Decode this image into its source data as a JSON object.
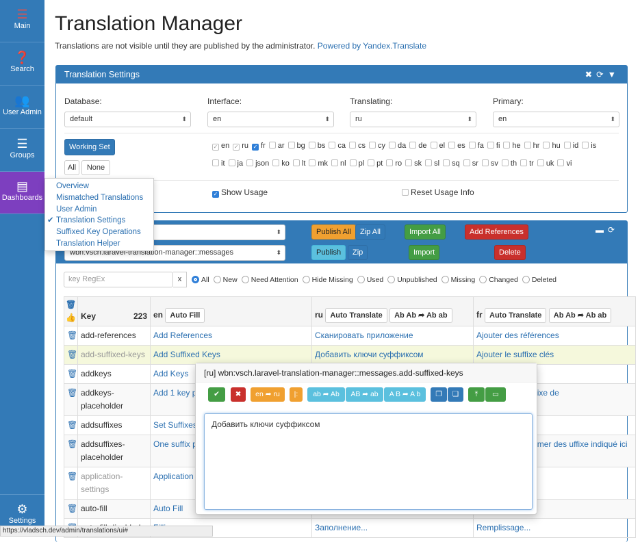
{
  "sidebar": {
    "items": [
      {
        "label": "Main",
        "icon": "hamburger-icon"
      },
      {
        "label": "Search",
        "icon": "question-icon"
      },
      {
        "label": "User Admin",
        "icon": "users-icon"
      },
      {
        "label": "Groups",
        "icon": "list-icon"
      },
      {
        "label": "Dashboards",
        "icon": "dashboard-icon"
      },
      {
        "label": "Settings",
        "icon": "gear-icon"
      }
    ]
  },
  "header": {
    "title": "Translation Manager",
    "intro": "Translations are not visible until they are published by the administrator.",
    "powered": "Powered by Yandex.Translate"
  },
  "settings": {
    "title": "Translation Settings",
    "database_label": "Database:",
    "database": "default",
    "interface_label": "Interface:",
    "interface": "en",
    "translating_label": "Translating:",
    "translating": "ru",
    "primary_label": "Primary:",
    "primary": "en",
    "working_set": "Working Set",
    "all": "All",
    "none": "None",
    "show_usage": "Show Usage",
    "reset_usage": "Reset Usage Info",
    "langs_row1": [
      {
        "code": "en",
        "state": "dim"
      },
      {
        "code": "ru",
        "state": "dim"
      },
      {
        "code": "fr",
        "state": "on"
      },
      {
        "code": "ar"
      },
      {
        "code": "bg"
      },
      {
        "code": "bs"
      },
      {
        "code": "ca"
      },
      {
        "code": "cs"
      },
      {
        "code": "cy"
      },
      {
        "code": "da"
      },
      {
        "code": "de"
      },
      {
        "code": "el"
      },
      {
        "code": "es"
      },
      {
        "code": "fa"
      },
      {
        "code": "fi"
      },
      {
        "code": "he"
      },
      {
        "code": "hr"
      },
      {
        "code": "hu"
      },
      {
        "code": "id"
      },
      {
        "code": "is"
      }
    ],
    "langs_row2": [
      "it",
      "ja",
      "json",
      "ko",
      "lt",
      "mk",
      "nl",
      "pl",
      "pt",
      "ro",
      "sk",
      "sl",
      "sq",
      "sr",
      "sv",
      "th",
      "tr",
      "uk",
      "vi"
    ]
  },
  "menu": {
    "items": [
      "Overview",
      "Mismatched Translations",
      "User Admin",
      "Translation Settings",
      "Suffixed Key Operations",
      "Translation Helper"
    ],
    "checked": "Translation Settings"
  },
  "groups": {
    "group": "wbn:vsch.laravel-translation-manager::messages",
    "publish_all": "Publish All",
    "zip_all": "Zip All",
    "import_all": "Import All",
    "add_references": "Add References",
    "publish": "Publish",
    "zip": "Zip",
    "import": "Import",
    "delete": "Delete"
  },
  "filter": {
    "placeholder": "key RegEx",
    "clear": "x",
    "options": [
      "All",
      "New",
      "Need Attention",
      "Hide Missing",
      "Used",
      "Unpublished",
      "Missing",
      "Changed",
      "Deleted"
    ],
    "selected": "All"
  },
  "table": {
    "key_header": "Key",
    "count": "223",
    "en": "en",
    "auto_fill": "Auto Fill",
    "ru": "ru",
    "fr": "fr",
    "auto_translate": "Auto Translate",
    "case": "Ab Ab ➦ Ab ab",
    "rows": [
      {
        "key": "add-references",
        "en": "Add References",
        "ru": "Сканировать приложение",
        "fr": "Ajouter des références"
      },
      {
        "key": "add-suffixed-keys",
        "en": "Add Suffixed Keys",
        "ru": "Добавить ключи суффиксом",
        "fr": "Ajouter le suffixe clés",
        "muted": true,
        "hl": true
      },
      {
        "key": "addkeys",
        "en": "Add Keys",
        "ru": "",
        "fr": "s"
      },
      {
        "key": "addkeys-placeholder",
        "en": "Add 1 key pe",
        "ru": "",
        "fr": "gne, sans le préfixe de"
      },
      {
        "key": "addsuffixes",
        "en": "Set Suffixes",
        "ru": "",
        "fr": "xes"
      },
      {
        "key": "addsuffixes-placeholder",
        "en": "One suffix p suffix keys b",
        "ru": "",
        "fr": "e. Ajouter/Supprimer des uffixe indiqué ici à chaque"
      },
      {
        "key": "application-settings",
        "en": "Application S",
        "ru": "",
        "fr": "e l'application",
        "muted": true
      },
      {
        "key": "auto-fill",
        "en": "Auto Fill",
        "ru": "",
        "fr": "matique"
      },
      {
        "key": "auto-fill-disabled",
        "en": "Filling...",
        "ru": "Заполнение...",
        "fr": "Remplissage..."
      }
    ]
  },
  "popup": {
    "title": "[ru] wbn:vsch.laravel-translation-manager::messages.add-suffixed-keys",
    "en_ru": "en ➦ ru",
    "sep": "|:",
    "b1": "ab ➦ Ab",
    "b2": "AB ➦ ab",
    "b3": "A B ➦ A b",
    "value": "Добавить ключи суффиксом"
  },
  "status": "https://vladsch.dev/admin/translations/ui#"
}
